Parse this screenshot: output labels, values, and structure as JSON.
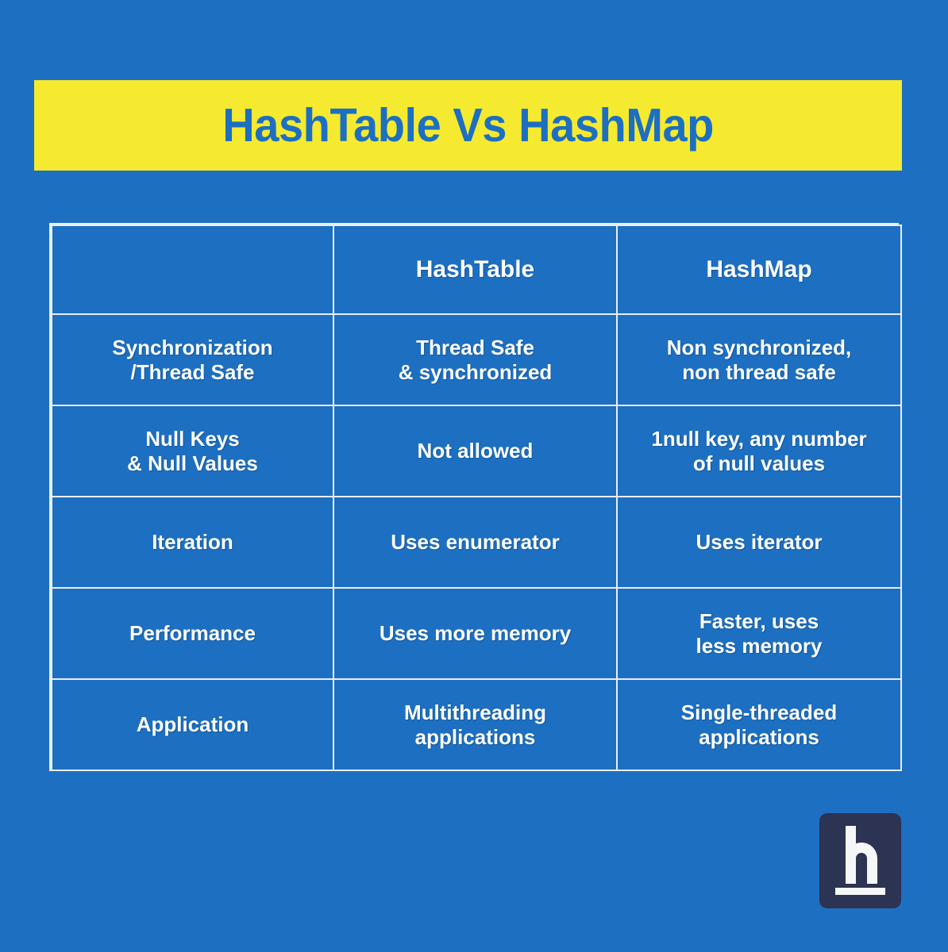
{
  "page": {
    "background_color": "#1d6fc1",
    "accent_yellow": "#f5ea2f",
    "text_white": "#ffffff",
    "logo_navy": "#2d3352",
    "border_color": "#e9eef5"
  },
  "title": {
    "text": "HashTable Vs HashMap"
  },
  "table": {
    "columns": [
      "",
      "HashTable",
      "HashMap"
    ],
    "rows": [
      {
        "feature": [
          "Synchronization",
          "/Thread Safe"
        ],
        "hashtable": [
          "Thread Safe",
          "& synchronized"
        ],
        "hashmap": [
          "Non synchronized,",
          "non thread safe"
        ]
      },
      {
        "feature": [
          "Null Keys",
          "& Null Values"
        ],
        "hashtable": [
          "Not allowed"
        ],
        "hashmap": [
          "1null key, any number",
          "of null values"
        ]
      },
      {
        "feature": [
          "Iteration"
        ],
        "hashtable": [
          "Uses enumerator"
        ],
        "hashmap": [
          "Uses iterator"
        ]
      },
      {
        "feature": [
          "Performance"
        ],
        "hashtable": [
          "Uses more memory"
        ],
        "hashmap": [
          "Faster, uses",
          "less memory"
        ]
      },
      {
        "feature": [
          "Application"
        ],
        "hashtable": [
          "Multithreading",
          "applications"
        ],
        "hashmap": [
          "Single-threaded",
          "applications"
        ]
      }
    ]
  },
  "logo": {
    "letter": "h"
  }
}
